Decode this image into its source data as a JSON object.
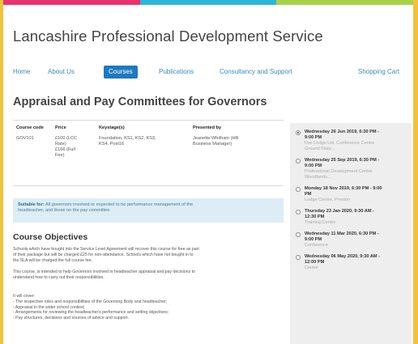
{
  "colors": {
    "border_gold": "#f2c23a",
    "strip": [
      "#e8336d",
      "#2fb4d9",
      "#a6d14a"
    ],
    "nav_active": "#1f78c1",
    "link": "#3a8bbd",
    "subsidy_bg": "#dcedf5",
    "sidebar_bg": "#eeeeee"
  },
  "header": {
    "title": "Lancashire Professional Development Service"
  },
  "nav": {
    "items": [
      {
        "label": "Home"
      },
      {
        "label": "About Us"
      },
      {
        "label": "Courses"
      },
      {
        "label": "Publications"
      },
      {
        "label": "Consultancy and Support"
      },
      {
        "label": "Shopping Cart"
      }
    ],
    "active": "Courses"
  },
  "page_title": "Appraisal and Pay Committees for Governors",
  "details": {
    "headers": {
      "code": "Course code",
      "price": "Price",
      "keystage": "Keystage(s)",
      "presented": "Presented by"
    },
    "values": {
      "code": "GOV101",
      "price_lines": [
        "£100 (LCC",
        "Rate)",
        "£166 (Full",
        "Fee)"
      ],
      "keystage_lines": [
        "Foundation, KS1, KS2, KS3,",
        "KS4, Post16"
      ],
      "presented_lines": [
        "Jeanette Whitham (HR",
        "Business Manager)"
      ]
    }
  },
  "subsidy": {
    "label": "Suitable for:",
    "text_line1": "All governors involved or expected to be performance management of the",
    "text_line2": "headteacher, and those on the pay committee"
  },
  "objectives": {
    "title": "Course Objectives",
    "para1_lines": [
      "Schools which have bought into the Service Level Agreement will recover this course for free as part",
      "of their package but will be charged £25 for non-attendance. Schools which have not bought in to",
      "the SLA will be charged the full course fee."
    ],
    "para2_lines": [
      "This course, is intended to help Governors involved in headteacher appraisal and pay decisions to",
      "understand how to carry out their responsibilities."
    ],
    "list_intro": "It will cover:",
    "bullets": [
      "- The respective roles and responsibilities of the Governing Body and headteacher;",
      "- Appraisal in the wider school context;",
      "- Arrangements for reviewing the headteacher's performance and setting objectives;",
      "- Pay structures, decisions and sources of advice and support."
    ]
  },
  "sessions": [
    {
      "date": "Wednesday 26 Jun 2019, 6:30 PM -",
      "date2": "9:00 PM",
      "loc_lines": [
        "Fire Lodge Ltd, Conference Centre",
        "Ground Floor..."
      ],
      "checked": true
    },
    {
      "date": "Wednesday 25 Sep 2019, 6:30 PM -",
      "date2": "9:00 PM",
      "loc_lines": [
        "Professional Development Centre",
        "Woodlands..."
      ],
      "checked": false
    },
    {
      "date": "Monday 18 Nov 2019, 6:30 PM - 9:00",
      "date2": "PM",
      "loc_lines": [
        "Lodge Centre, Preston"
      ],
      "checked": false
    },
    {
      "date": "Thursday 23 Jan 2020, 9:30 AM -",
      "date2": "12:30 PM",
      "loc_lines": [
        "Training Centre"
      ],
      "checked": false
    },
    {
      "date": "Wednesday 11 Mar 2020, 6:30 PM -",
      "date2": "9:00 PM",
      "loc_lines": [
        "Conference"
      ],
      "checked": false
    },
    {
      "date": "Wednesday 06 May 2020, 9:30 AM -",
      "date2": "12:00 PM",
      "loc_lines": [
        "Centre"
      ],
      "checked": false
    }
  ]
}
